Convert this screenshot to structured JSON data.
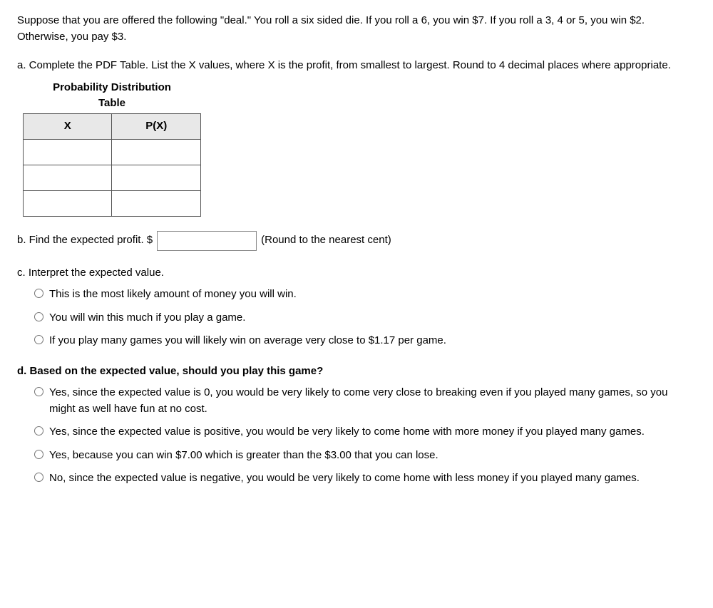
{
  "intro": {
    "text": "Suppose that you are offered the following \"deal.\" You roll a six sided die. If you roll a 6, you win $7. If you roll a 3, 4 or 5, you win $2. Otherwise, you pay $3."
  },
  "part_a": {
    "label": "a. Complete the PDF Table. List the X values, where X is the profit, from smallest to largest. Round to 4 decimal places where appropriate.",
    "table": {
      "title_line1": "Probability Distribution",
      "title_line2": "Table",
      "col_x": "X",
      "col_px": "P(X)",
      "rows": [
        {
          "x": "",
          "px": ""
        },
        {
          "x": "",
          "px": ""
        },
        {
          "x": "",
          "px": ""
        }
      ]
    }
  },
  "part_b": {
    "label": "b. Find the expected profit. $",
    "suffix": "(Round to the nearest cent)",
    "input_value": ""
  },
  "part_c": {
    "label": "c. Interpret the expected value.",
    "options": [
      {
        "id": "c1",
        "text": "This is the most likely amount of money you will win."
      },
      {
        "id": "c2",
        "text": "You will win this much if you play a game."
      },
      {
        "id": "c3",
        "text": "If you play many games you will likely win on average very close to $1.17 per game."
      }
    ]
  },
  "part_d": {
    "label": "d. Based on the expected value, should you play this game?",
    "options": [
      {
        "id": "d1",
        "text": "Yes, since the expected value is 0, you would be very likely to come very close to breaking even if you played many games, so you might as well have fun at no cost."
      },
      {
        "id": "d2",
        "text": "Yes, since the expected value is positive, you would be very likely to come home with more money if you played many games."
      },
      {
        "id": "d3",
        "text": "Yes, because you can win $7.00 which is greater than the $3.00 that you can lose."
      },
      {
        "id": "d4",
        "text": "No, since the expected value is negative, you would be very likely to come home with less money if you played many games."
      }
    ]
  }
}
